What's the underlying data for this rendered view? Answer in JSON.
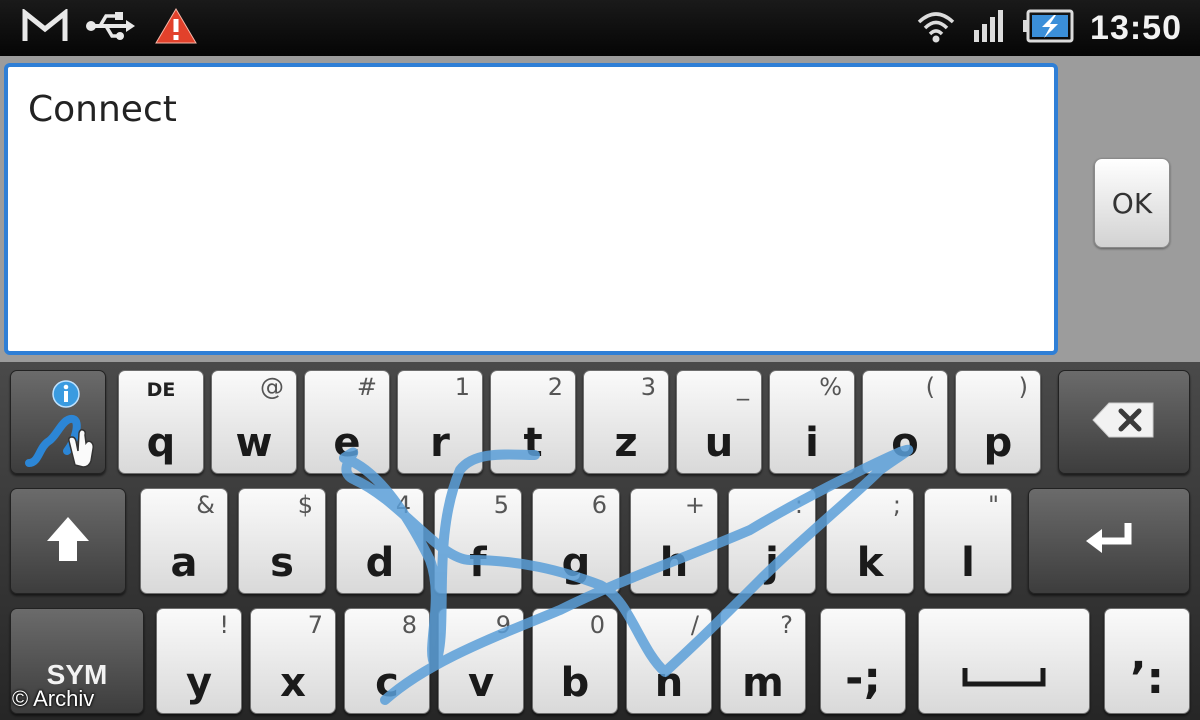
{
  "status_bar": {
    "time": "13:50",
    "left_icons": [
      "gmail-icon",
      "usb-icon",
      "warning-icon"
    ],
    "right_icons": [
      "wifi-icon",
      "signal-icon",
      "battery-charging-icon"
    ]
  },
  "input": {
    "text": "Connect"
  },
  "ok_button": {
    "label": "OK"
  },
  "keyboard": {
    "swype_key": {
      "icon": "swype-icon",
      "info_icon": "info-icon"
    },
    "language_hint": "DE",
    "row1": [
      {
        "main": "q",
        "sub": ""
      },
      {
        "main": "w",
        "sub": "@"
      },
      {
        "main": "e",
        "sub": "#"
      },
      {
        "main": "r",
        "sub": "1"
      },
      {
        "main": "t",
        "sub": "2"
      },
      {
        "main": "z",
        "sub": "3"
      },
      {
        "main": "u",
        "sub": "_"
      },
      {
        "main": "i",
        "sub": "%"
      },
      {
        "main": "o",
        "sub": "("
      },
      {
        "main": "p",
        "sub": ")"
      }
    ],
    "row2": [
      {
        "main": "a",
        "sub": "&"
      },
      {
        "main": "s",
        "sub": "$"
      },
      {
        "main": "d",
        "sub": "4"
      },
      {
        "main": "f",
        "sub": "5"
      },
      {
        "main": "g",
        "sub": "6"
      },
      {
        "main": "h",
        "sub": "+"
      },
      {
        "main": "j",
        "sub": ":"
      },
      {
        "main": "k",
        "sub": ";"
      },
      {
        "main": "l",
        "sub": "\""
      }
    ],
    "row3": [
      {
        "main": "y",
        "sub": "!"
      },
      {
        "main": "x",
        "sub": "7"
      },
      {
        "main": "c",
        "sub": "8"
      },
      {
        "main": "v",
        "sub": "9"
      },
      {
        "main": "b",
        "sub": "0"
      },
      {
        "main": "n",
        "sub": "/"
      },
      {
        "main": "m",
        "sub": "?"
      }
    ],
    "punct_key": {
      "main": "-;"
    },
    "apostrophe_key": {
      "main": "’:"
    },
    "sym_label": "SYM",
    "icons": {
      "backspace": "backspace-icon",
      "shift": "shift-icon",
      "enter": "enter-icon",
      "space": "space-icon"
    }
  },
  "swipe_trace_color": "#5b9fd8",
  "watermark": "© Archiv"
}
